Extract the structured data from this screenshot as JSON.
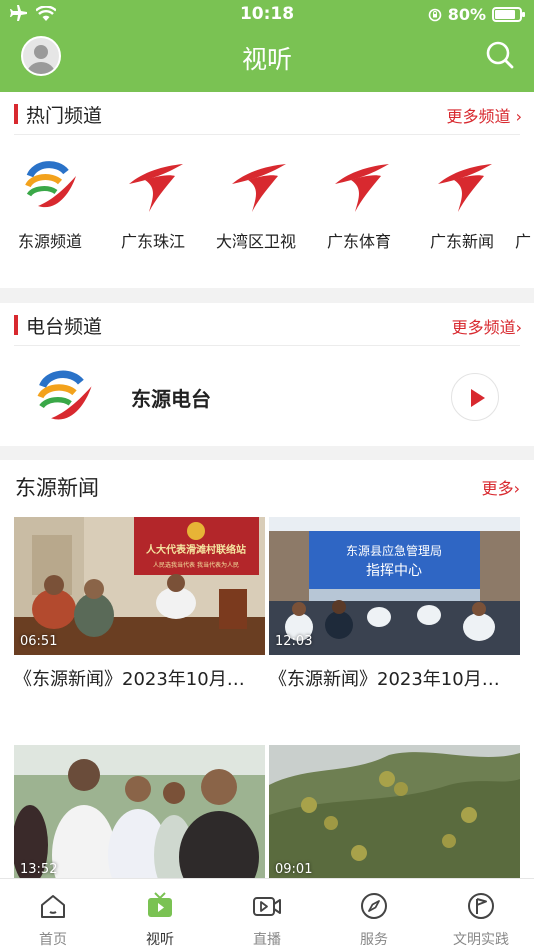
{
  "status_bar": {
    "time": "10:18",
    "battery": "80%"
  },
  "header": {
    "title": "视听"
  },
  "hot_channels": {
    "title": "热门频道",
    "more": "更多频道",
    "items": [
      {
        "name": "东源频道",
        "logo": "dongyuan-logo"
      },
      {
        "name": "广东珠江",
        "logo": "guangdong-tv-logo"
      },
      {
        "name": "大湾区卫视",
        "logo": "guangdong-tv-logo"
      },
      {
        "name": "广东体育",
        "logo": "guangdong-tv-logo"
      },
      {
        "name": "广东新闻",
        "logo": "guangdong-tv-logo"
      }
    ]
  },
  "radio": {
    "title": "电台频道",
    "more": "更多频道",
    "item": {
      "name": "东源电台"
    }
  },
  "news": {
    "title": "东源新闻",
    "more": "更多",
    "items": [
      {
        "title": "《东源新闻》2023年10月…",
        "duration": "06:51",
        "overlay_banner": "人大代表滑滩村联络站",
        "overlay_sub": "人民选我当代表 我当代表为人民"
      },
      {
        "title": "《东源新闻》2023年10月…",
        "duration": "12:03",
        "overlay_banner": "东源县应急管理局",
        "overlay_sub": "指挥中心"
      },
      {
        "title": "",
        "duration": "13:52"
      },
      {
        "title": "",
        "duration": "09:01"
      }
    ]
  },
  "tabbar": {
    "items": [
      {
        "label": "首页",
        "icon": "home-icon"
      },
      {
        "label": "视听",
        "icon": "tv-icon"
      },
      {
        "label": "直播",
        "icon": "live-video-icon"
      },
      {
        "label": "服务",
        "icon": "compass-icon"
      },
      {
        "label": "文明实践",
        "icon": "flag-icon"
      }
    ],
    "active": 1
  },
  "colors": {
    "brand_green": "#7ac253",
    "accent_red": "#d8292f"
  }
}
